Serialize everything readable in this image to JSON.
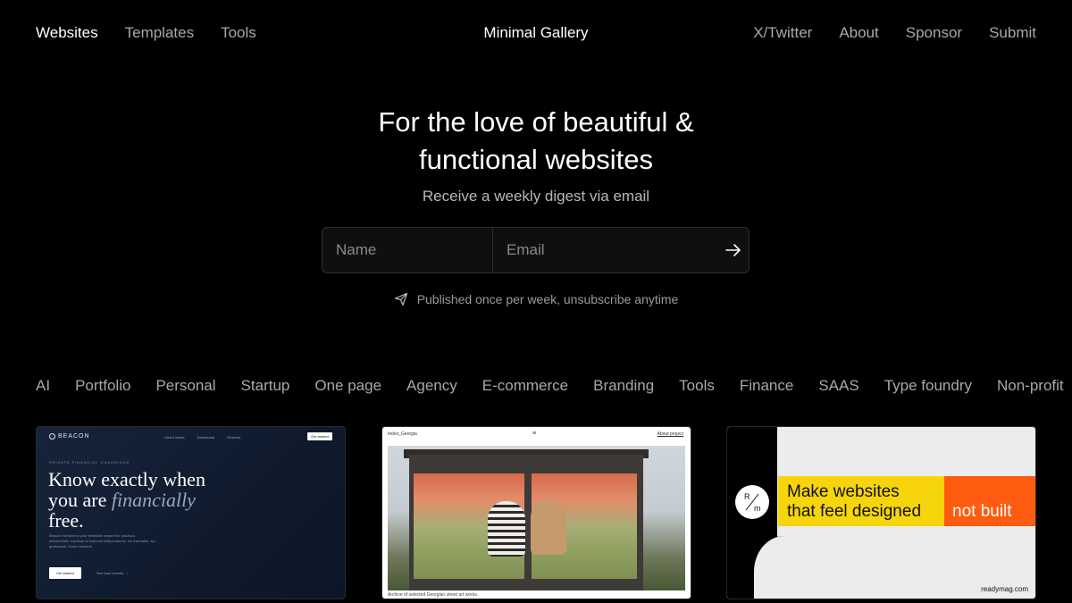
{
  "nav": {
    "left": [
      {
        "label": "Websites",
        "active": true
      },
      {
        "label": "Templates",
        "active": false
      },
      {
        "label": "Tools",
        "active": false
      }
    ],
    "brand": "Minimal Gallery",
    "right": [
      "X/Twitter",
      "About",
      "Sponsor",
      "Submit"
    ]
  },
  "hero": {
    "title_line1": "For the love of beautiful &",
    "title_line2": "functional websites",
    "subtitle": "Receive a weekly digest via email",
    "name_placeholder": "Name",
    "email_placeholder": "Email",
    "submit_icon": "arrow-right-icon",
    "note_icon": "paper-plane-icon",
    "note": "Published once per week, unsubscribe anytime"
  },
  "categories": [
    "AI",
    "Portfolio",
    "Personal",
    "Startup",
    "One page",
    "Agency",
    "E-commerce",
    "Branding",
    "Tools",
    "Finance",
    "SAAS",
    "Type foundry",
    "Non-profit"
  ],
  "cards": {
    "beacon": {
      "logo": "BEACON",
      "nav": [
        "How it works",
        "Dashboard",
        "Reviews"
      ],
      "button": "Get started",
      "eyebrow": "PRIVATE FINANCIAL GUARDIANS",
      "headline_1": "Know exactly when",
      "headline_2a": "you are ",
      "headline_2b": "financially",
      "headline_3": "free.",
      "paragraph": "Beacon transforms your timetable toward the practical, deterministic roadmap to financial independence. No estimates. No guesswork. Exact numbers.",
      "cta": "Get started",
      "link": "See how it works  →"
    },
    "index": {
      "title": "Index_Georgia",
      "menu_icon": "hamburger-icon",
      "about": "About project",
      "caption": "Archive of selected Georgian street art works."
    },
    "readymag": {
      "logo_top": "R",
      "logo_bottom": "m",
      "yellow_1": "Make websites",
      "yellow_2": "that feel designed",
      "orange": "not built",
      "domain": "readymag.com"
    }
  },
  "colors": {
    "background": "#000000",
    "text_primary": "#ffffff",
    "text_muted": "#a8a8a8",
    "readymag_yellow": "#f6d50d",
    "readymag_orange": "#ff5b10"
  }
}
